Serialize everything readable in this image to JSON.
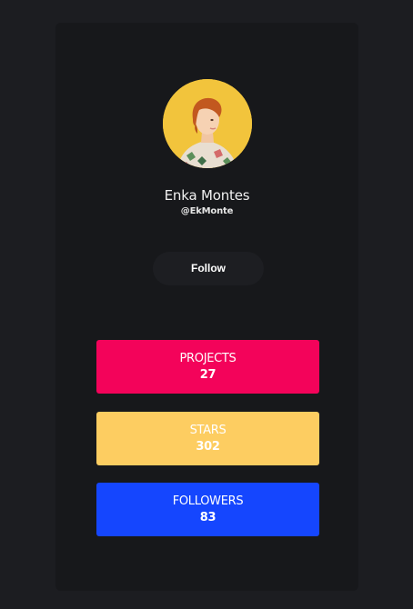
{
  "profile": {
    "name": "Enka Montes",
    "handle": "@EkMonte",
    "follow_label": "Follow"
  },
  "stats": [
    {
      "label": "PROJECTS",
      "value": "27",
      "color": "#f3035a"
    },
    {
      "label": "STARS",
      "value": "302",
      "color": "#fdcd61"
    },
    {
      "label": "FOLLOWERS",
      "value": "83",
      "color": "#1546fe"
    }
  ],
  "colors": {
    "page_background": "#1c1d21",
    "card_background": "#17181b",
    "avatar_background": "#f2c43c",
    "follow_button_background": "#1d1e22"
  }
}
